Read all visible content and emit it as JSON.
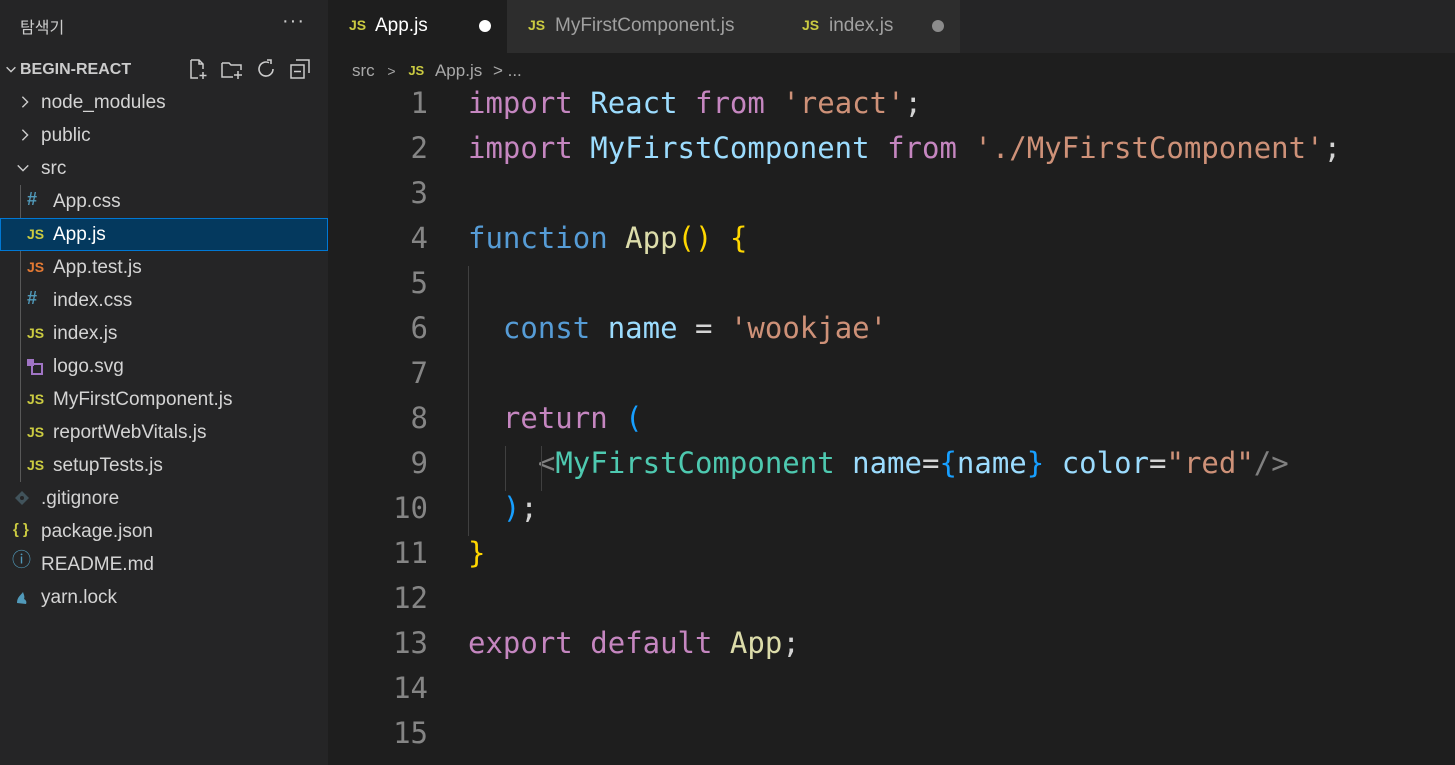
{
  "explorer": {
    "title": "탐색기",
    "more_label": "···",
    "section_name": "BEGIN-REACT",
    "items": [
      {
        "label": "node_modules",
        "kind": "folder",
        "icon": "chevron-right-icon"
      },
      {
        "label": "public",
        "kind": "folder",
        "icon": "chevron-right-icon"
      },
      {
        "label": "src",
        "kind": "folder-open",
        "icon": "chevron-down-icon"
      },
      {
        "label": "App.css",
        "kind": "css",
        "badge": "#"
      },
      {
        "label": "App.js",
        "kind": "js",
        "badge": "JS",
        "selected": true
      },
      {
        "label": "App.test.js",
        "kind": "test",
        "badge": "JS"
      },
      {
        "label": "index.css",
        "kind": "css",
        "badge": "#"
      },
      {
        "label": "index.js",
        "kind": "js",
        "badge": "JS"
      },
      {
        "label": "logo.svg",
        "kind": "svg"
      },
      {
        "label": "MyFirstComponent.js",
        "kind": "js",
        "badge": "JS"
      },
      {
        "label": "reportWebVitals.js",
        "kind": "js",
        "badge": "JS"
      },
      {
        "label": "setupTests.js",
        "kind": "js",
        "badge": "JS"
      },
      {
        "label": ".gitignore",
        "kind": "git"
      },
      {
        "label": "package.json",
        "kind": "json",
        "badge": "{ }"
      },
      {
        "label": "README.md",
        "kind": "info",
        "badge": "ⓘ"
      },
      {
        "label": "yarn.lock",
        "kind": "yarn"
      }
    ]
  },
  "tabs": [
    {
      "badge": "JS",
      "label": "App.js",
      "active": true,
      "dirty": true
    },
    {
      "badge": "JS",
      "label": "MyFirstComponent.js",
      "active": false,
      "dirty": false
    },
    {
      "badge": "JS",
      "label": "index.js",
      "active": false,
      "dirty": true
    }
  ],
  "breadcrumb": {
    "folder": "src",
    "sep": ">",
    "file_badge": "JS",
    "file": "App.js",
    "tail": "> ..."
  },
  "editor": {
    "line_numbers": [
      "1",
      "2",
      "3",
      "4",
      "5",
      "6",
      "7",
      "8",
      "9",
      "10",
      "11",
      "12",
      "13",
      "14",
      "15"
    ],
    "lines": [
      [
        [
          "kw",
          "import"
        ],
        [
          "t",
          " "
        ],
        [
          "id",
          "React"
        ],
        [
          "t",
          " "
        ],
        [
          "kw",
          "from"
        ],
        [
          "t",
          " "
        ],
        [
          "str",
          "'react'"
        ],
        [
          "t",
          ";"
        ]
      ],
      [
        [
          "kw",
          "import"
        ],
        [
          "t",
          " "
        ],
        [
          "id",
          "MyFirstComponent"
        ],
        [
          "t",
          " "
        ],
        [
          "kw",
          "from"
        ],
        [
          "t",
          " "
        ],
        [
          "str",
          "'./MyFirstComponent'"
        ],
        [
          "t",
          ";"
        ]
      ],
      [],
      [
        [
          "kb",
          "function"
        ],
        [
          "t",
          " "
        ],
        [
          "fn",
          "App"
        ],
        [
          "br",
          "()"
        ],
        [
          "t",
          " "
        ],
        [
          "br",
          "{"
        ]
      ],
      [],
      [
        [
          "t",
          "  "
        ],
        [
          "kb",
          "const"
        ],
        [
          "t",
          " "
        ],
        [
          "id",
          "name"
        ],
        [
          "t",
          " = "
        ],
        [
          "str",
          "'wookjae'"
        ]
      ],
      [],
      [
        [
          "t",
          "  "
        ],
        [
          "kw",
          "return"
        ],
        [
          "t",
          " "
        ],
        [
          "br2",
          "("
        ]
      ],
      [
        [
          "t",
          "    "
        ],
        [
          "gray",
          "<"
        ],
        [
          "tg",
          "MyFirstComponent"
        ],
        [
          "t",
          " "
        ],
        [
          "id",
          "name"
        ],
        [
          "t",
          "="
        ],
        [
          "br2",
          "{"
        ],
        [
          "id",
          "name"
        ],
        [
          "br2",
          "}"
        ],
        [
          "t",
          " "
        ],
        [
          "id",
          "color"
        ],
        [
          "t",
          "="
        ],
        [
          "str",
          "\"red\""
        ],
        [
          "gray",
          "/>"
        ]
      ],
      [
        [
          "t",
          "  "
        ],
        [
          "br2",
          ")"
        ],
        [
          "t",
          ";"
        ]
      ],
      [
        [
          "br",
          "}"
        ]
      ],
      [],
      [
        [
          "kw",
          "export"
        ],
        [
          "t",
          " "
        ],
        [
          "kw",
          "default"
        ],
        [
          "t",
          " "
        ],
        [
          "fn",
          "App"
        ],
        [
          "t",
          ";"
        ]
      ],
      [],
      []
    ]
  },
  "colors": {
    "sidebar_bg": "#252526",
    "editor_bg": "#1e1e1e",
    "selection_bg": "#04395e",
    "selection_border": "#0078d4",
    "js_badge": "#cbcb41",
    "css_badge": "#519aba",
    "test_badge": "#e37933",
    "svg_icon": "#a074c4"
  }
}
